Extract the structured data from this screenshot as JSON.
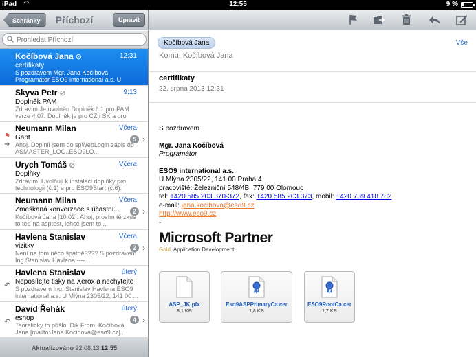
{
  "status": {
    "carrier": "iPad",
    "time": "12:55",
    "battery": "9 %"
  },
  "left": {
    "back_label": "Schránky",
    "title": "Příchozí",
    "edit_label": "Upravit",
    "search_placeholder": "Prohledat Příchozí",
    "messages": [
      {
        "sender": "Kočíbová Jana",
        "date": "12:31",
        "subject": "certifikaty",
        "preview": "S pozdravem Mgr. Jana Kočíbová Programátor ESO9 international a.s. U Mlýna ..."
      },
      {
        "sender": "Skyva Petr",
        "date": "9:13",
        "subject": "Doplněk PAM",
        "preview": "Zdravím Je uvolněn Doplněk č.1 pro PAM verze 4.07. Doplněk je pro CZ i SK a pro ob..."
      },
      {
        "sender": "Neumann Milan",
        "date": "Včera",
        "subject": "Gant",
        "preview": "Ahoj. Doplnil jsem do spWebLogin zápis do ASMASTER_LOG..ESO9LO...",
        "badge": "5"
      },
      {
        "sender": "Urych Tomáš",
        "date": "Včera",
        "subject": "Doplňky",
        "preview": "Zdravím, Uvolňuji k instalaci doplňky pro technologii (č.1) a pro ESO9Start (č.6). Oba..."
      },
      {
        "sender": "Neumann Milan",
        "date": "Včera",
        "subject": "Zmeškaná konverzace s účastní...",
        "preview": "Kočíbová Jana [10:02]: Ahoj, prosím tě zkus to teď na asptest, lehce jsem to...",
        "badge": "2"
      },
      {
        "sender": "Havlena Stanislav",
        "date": "Včera",
        "subject": "vizitky",
        "preview": "Není na tom něco špatně???? S pozdravem Ing.Stanislav Havlena ----...",
        "badge": "2"
      },
      {
        "sender": "Havlena Stanislav",
        "date": "úterý",
        "subject": "Neposílejte tisky na Xerox a nechytejte...",
        "preview": "S pozdravem Ing. Stanislav Havlena ESO9 international a.s. U Mlýna 2305/22, 141 00 ..."
      },
      {
        "sender": "David Řehák",
        "date": "úterý",
        "subject": "eshop",
        "preview": "Teoreticky to přišlo. Dik From: Kočíbová Jana [mailto:Jana.Kocibova@eso9.cz]...",
        "badge": "4"
      }
    ],
    "footer_label": "Aktualizováno",
    "footer_date": "22.08.13",
    "footer_time": "12:55"
  },
  "mail": {
    "from": "Kočíbová Jana",
    "show_all": "Vše",
    "to": "Komu: Kočíbová Jana",
    "subject": "certifikaty",
    "date": "22. srpna 2013 12:31",
    "greeting": "S pozdravem",
    "name": "Mgr. Jana Kočíbová",
    "role": "Programátor",
    "company": "ESO9 international a.s.",
    "address1": "U Mlýna 2305/22, 141 00 Praha 4",
    "address2": "pracoviště: Železniční 548/4B, 779 00 Olomouc",
    "tel_label": "tel: ",
    "tel": "+420 585 203 370-372",
    "fax_label": ", fax: ",
    "fax": "+420 585 203 373",
    "mobil_label": ", mobil: ",
    "mobil": "+420 739 418 782",
    "email_label": "e-mail: ",
    "email": "jana.kocibova@eso9.cz",
    "web": "http://www.eso9.cz",
    "dash": "-",
    "logo_word": "Microsoft Partner",
    "logo_gold": "Gold",
    "logo_sub": "Application Development",
    "attachments": [
      {
        "name": "ASP_JK.pfx",
        "size": "8,1 KB"
      },
      {
        "name": "Eso9ASPPrimaryCa.cer",
        "size": "1,8 KB"
      },
      {
        "name": "ESO9RootCa.cer",
        "size": "1,7 KB"
      }
    ]
  },
  "colors": {
    "accent": "#0b6ad8",
    "link": "#0000ee",
    "orange_link": "#e8762d"
  }
}
